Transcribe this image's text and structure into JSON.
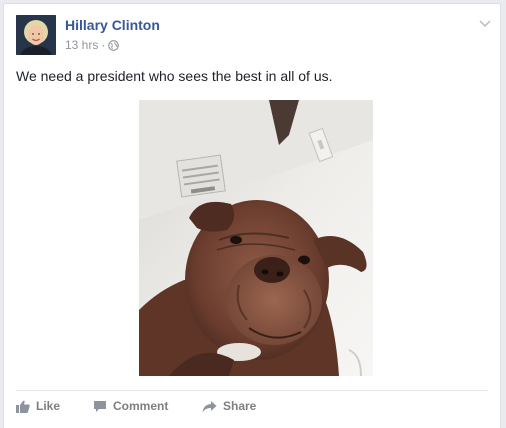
{
  "post": {
    "author": "Hillary Clinton",
    "time": "13 hrs",
    "separator": "·",
    "privacy_icon": "globe-icon",
    "menu_icon": "chevron-down-icon",
    "text": "We need a president who sees the best in all of us.",
    "photo_subject": "dog-photo"
  },
  "actions": {
    "like_label": "Like",
    "comment_label": "Comment",
    "share_label": "Share"
  },
  "colors": {
    "author_link": "#365899",
    "meta_gray": "#90949c",
    "action_gray": "#7f7f7f",
    "text": "#1d2129"
  }
}
